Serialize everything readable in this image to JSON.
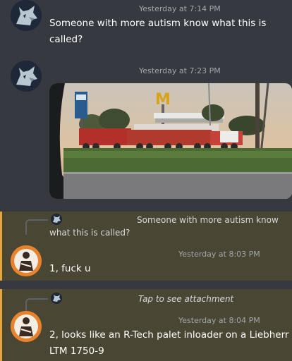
{
  "messages": [
    {
      "timestamp": "Yesterday at 7:14 PM",
      "text_line1": "Someone with more autism know what this is",
      "text_line2": "called?"
    },
    {
      "timestamp": "Yesterday at 7:23 PM",
      "attachment": {
        "sign_letter": "M"
      }
    },
    {
      "reply_line1": "Someone with more autism know",
      "reply_line2": "what this is called?",
      "timestamp": "Yesterday at 8:03 PM",
      "text": "1, fuck u"
    },
    {
      "reply": "Tap to see attachment",
      "timestamp": "Yesterday at 8:04 PM",
      "text_line1": "2, looks like an R-Tech palet inloader on a Liebherr",
      "text_line2": "LTM 1750-9"
    }
  ],
  "colors": {
    "background": "#36393f",
    "mention_highlight": "#4a4634",
    "mention_bar": "#e3a63a",
    "timestamp": "#a3a6aa"
  },
  "icons": [
    "wolf-avatar-icon",
    "user-avatar-icon",
    "reply-avatar-icon"
  ]
}
